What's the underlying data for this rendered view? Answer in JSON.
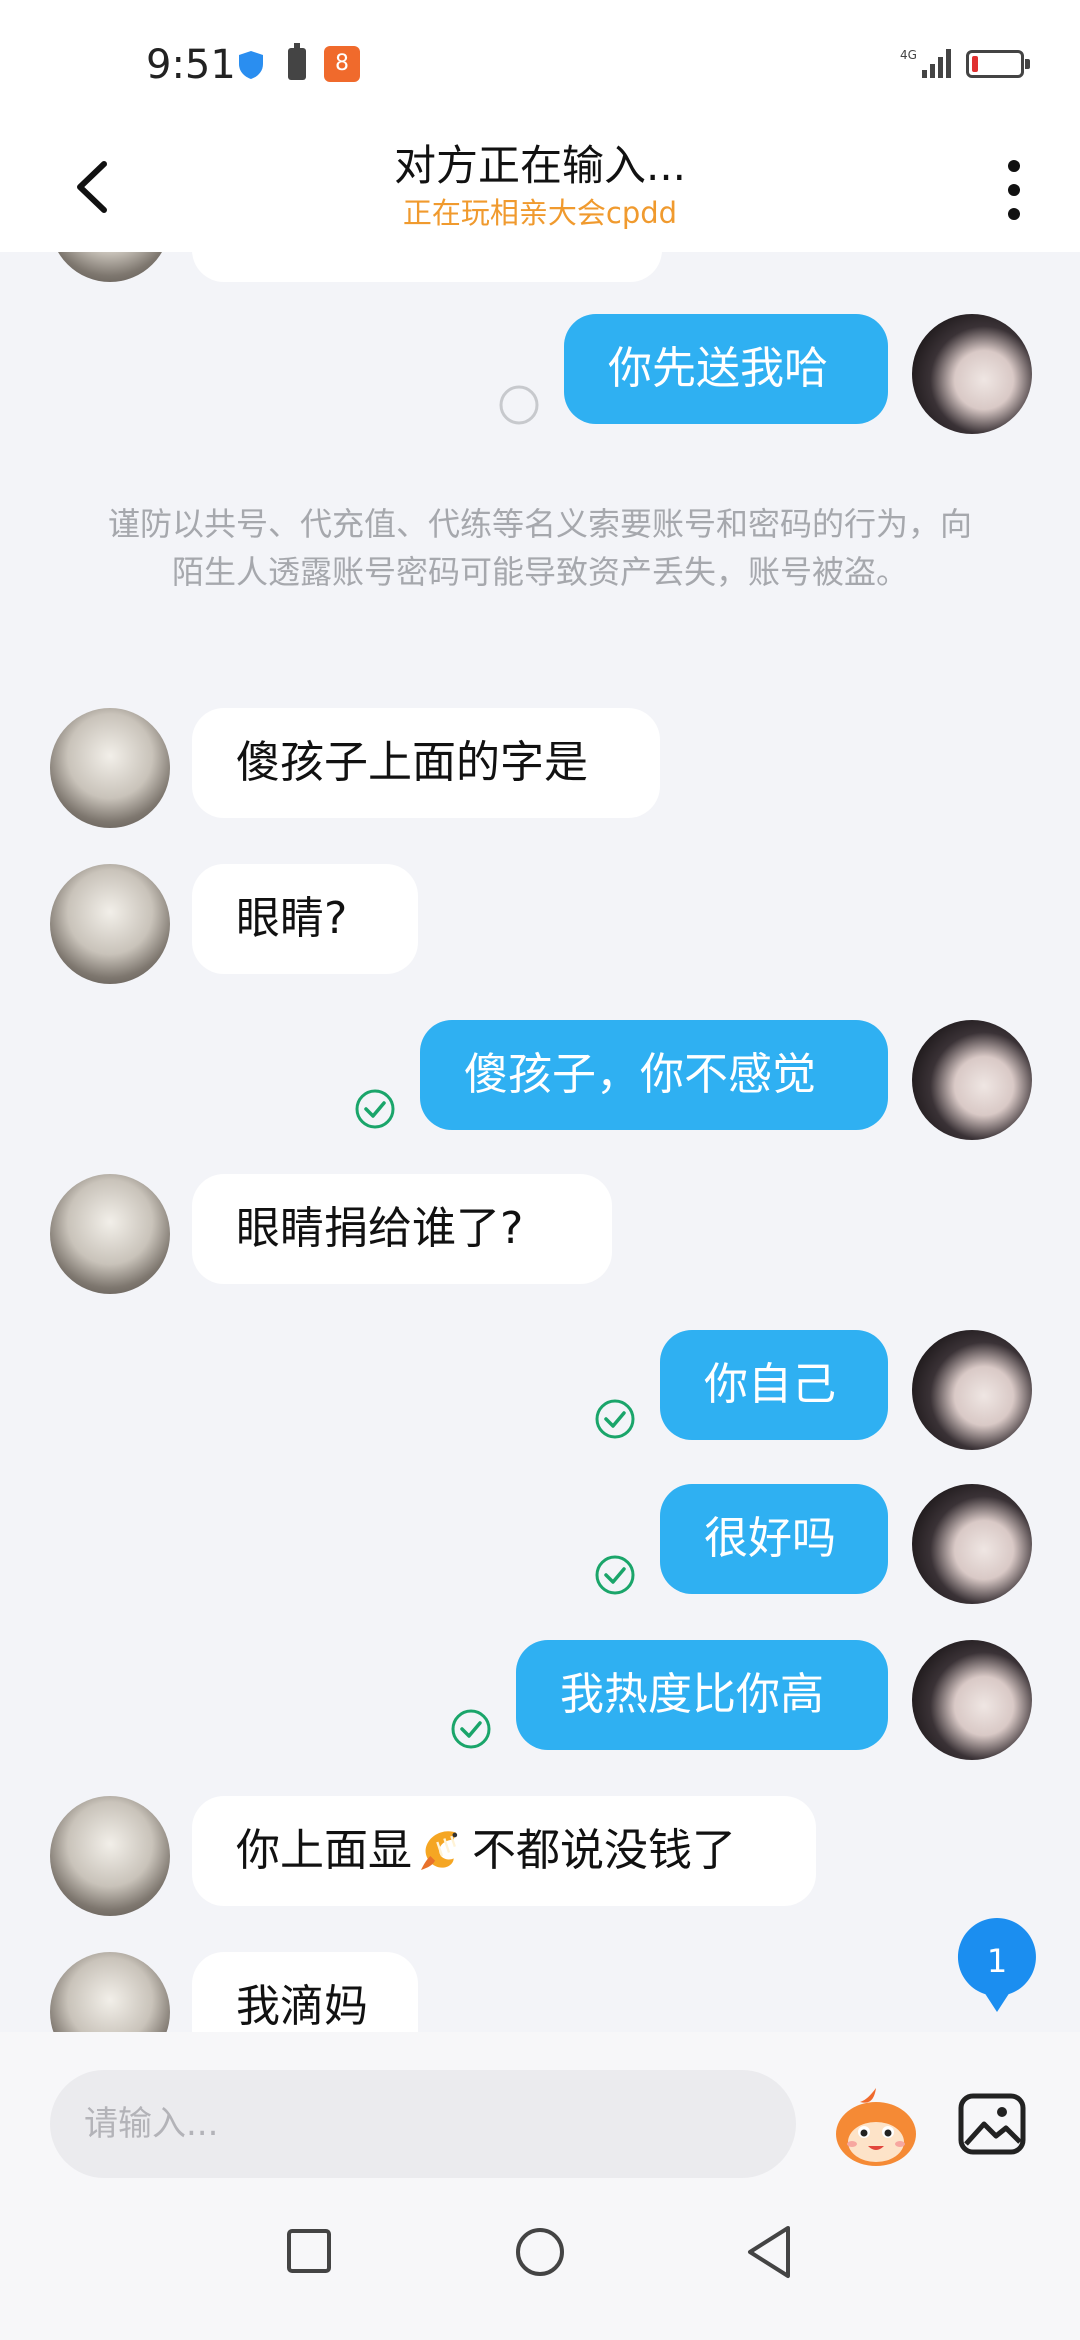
{
  "status_bar": {
    "time": "9:51",
    "app_icon_text": "8",
    "network": "4G",
    "icons": [
      "shield-icon",
      "battery-icon",
      "app-icon",
      "signal-icon",
      "battery-low-icon"
    ]
  },
  "header": {
    "title": "对方正在输入...",
    "subtitle": "正在玩相亲大会cpdd",
    "icons": [
      "back-arrow-icon",
      "more-vertical-icon"
    ]
  },
  "chat": {
    "warning": "谨防以共号、代充值、代练等名义索要账号和密码的行为，向陌生人透露账号密码可能导致资产丢失，账号被盗。",
    "messages": [
      {
        "from": "me",
        "text": "你先送我哈",
        "status": "sending"
      },
      {
        "from": "other",
        "text": "傻孩子上面的字是"
      },
      {
        "from": "other",
        "text": "眼睛?"
      },
      {
        "from": "me",
        "text": "傻孩子，你不感觉",
        "status": "read"
      },
      {
        "from": "other",
        "text": "眼睛捐给谁了?"
      },
      {
        "from": "me",
        "text": "你自己",
        "status": "read"
      },
      {
        "from": "me",
        "text": "很好吗",
        "status": "read"
      },
      {
        "from": "me",
        "text": "我热度比你高",
        "status": "read"
      },
      {
        "from": "other",
        "text_before": "你上面显",
        "emoji": "shrimp-emoji",
        "text_after": "不都说没钱了"
      },
      {
        "from": "other",
        "text": "我滴妈"
      }
    ],
    "unread_count": "1"
  },
  "input_bar": {
    "placeholder": "请输入...",
    "icons": [
      "emoji-mascot-icon",
      "image-icon"
    ]
  },
  "nav_bar": {
    "icons": [
      "recent-apps-icon",
      "home-icon",
      "back-icon"
    ]
  },
  "colors": {
    "my_bubble": "#2fb0f2",
    "subtitle": "#f09a2e",
    "read_check": "#1aa56a",
    "unread_badge": "#1b8ef0"
  }
}
